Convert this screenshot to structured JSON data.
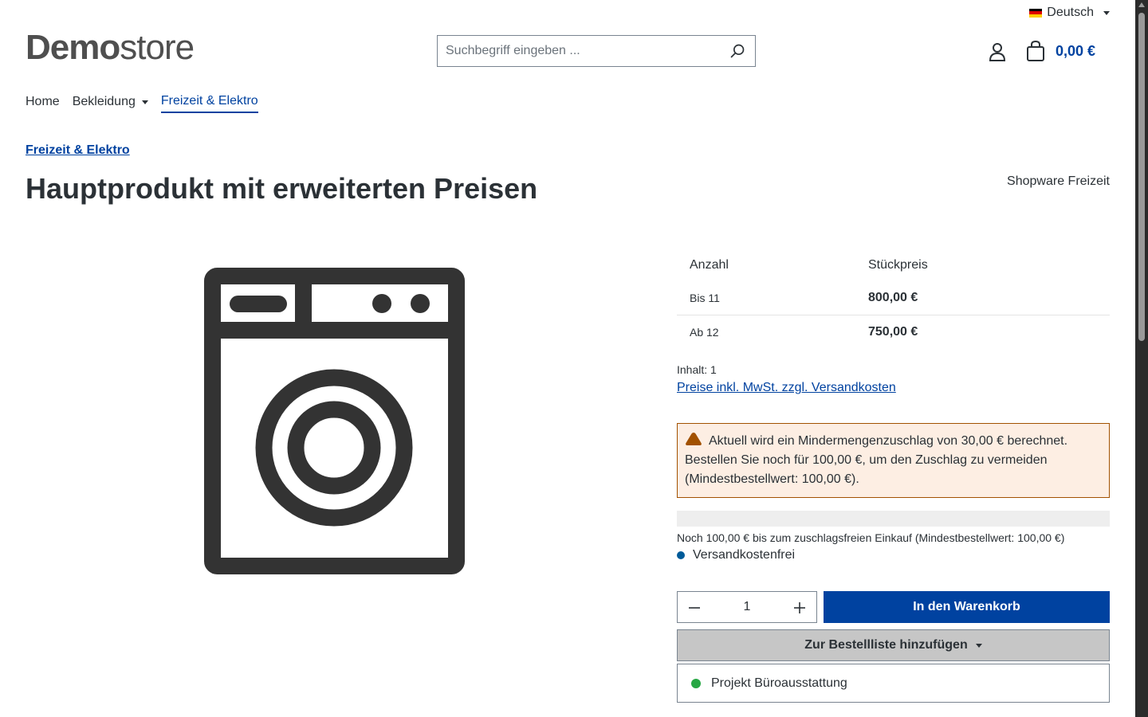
{
  "language": {
    "label": "Deutsch",
    "flag_colors": [
      "#000000",
      "#dd0000",
      "#ffce00"
    ]
  },
  "logo": {
    "bold": "Demo",
    "light": "store"
  },
  "search": {
    "placeholder": "Suchbegriff eingeben ..."
  },
  "header": {
    "cart_total": "0,00 €"
  },
  "nav": {
    "items": [
      {
        "label": "Home"
      },
      {
        "label": "Bekleidung"
      },
      {
        "label": "Freizeit & Elektro"
      }
    ]
  },
  "breadcrumb": {
    "label": "Freizeit & Elektro"
  },
  "product": {
    "title": "Hauptprodukt mit erweiterten Preisen",
    "manufacturer": "Shopware Freizeit",
    "image_icon": "washing-machine-icon"
  },
  "price_table": {
    "headers": {
      "quantity": "Anzahl",
      "unit_price": "Stückpreis"
    },
    "rows": [
      {
        "quantity": "Bis 11",
        "price": "800,00 €"
      },
      {
        "quantity": "Ab 12",
        "price": "750,00 €"
      }
    ]
  },
  "content_info": "Inhalt: 1",
  "tax_link": "Preise inkl. MwSt. zzgl. Versandkosten",
  "alert": {
    "text": "Aktuell wird ein Mindermengenzuschlag von 30,00 € berechnet. Bestellen Sie noch für 100,00 €, um den Zuschlag zu vermeiden (Mindestbestellwert: 100,00 €).",
    "icon": "warning-icon",
    "color": "#a25100"
  },
  "progress": {
    "fraction": 0,
    "text": "Noch 100,00 € bis zum zuschlagsfreien Einkauf (Mindestbestellwert: 100,00 €)"
  },
  "delivery": {
    "label": "Versandkostenfrei",
    "dot_color": "#005b99"
  },
  "quantity": {
    "value": "1"
  },
  "buy_button": {
    "label": "In den Warenkorb"
  },
  "orderlist": {
    "button_label": "Zur Bestellliste hinzufügen",
    "items": [
      {
        "label": "Projekt Büroausstattung",
        "dot_color": "#28a745"
      }
    ]
  },
  "colors": {
    "primary": "#0042a0",
    "text": "#2b3136"
  }
}
